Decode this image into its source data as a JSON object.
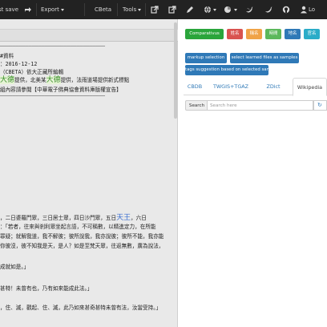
{
  "navbar": {
    "last_save": "st save",
    "export_label": "Export",
    "cbeta_label": "CBeta",
    "tools_label": "Tools",
    "user_label": "Lo",
    "icons": [
      "share-icon",
      "chevron-down-icon",
      "external-link-icon",
      "external-link-icon",
      "pencil-icon",
      "globe-icon",
      "pie-chart-icon",
      "twitter-icon",
      "github-icon",
      "user-icon"
    ]
  },
  "document": {
    "lines": [
      "─────────────────────────────────",
      "#資料",
      "：2016-12-12",
      "（CBETA）依大正藏所編輯",
      "提供，北美某",
      "提供，法雨道場提供新式標點",
      "組內容請參閱【中華電子佛典協會資料庫版權宣告】",
      "─────────────────────────────────",
      "，二日婆羅門眾，三日居士眾，四日沙門眾，五日",
      "，六日",
      "：「若者，往來與剎利眾坐起言語，不可稱數，以精進定力，在所能",
      "罪疑；就解我道，我不解彼；彼所說我，我亦說彼；彼所不能，我亦能",
      "你彼沒，彼不知我是天，是人？如是至梵天眾，往返無數，廣為說法，",
      "成就如是。」",
      "甚特！未曾有也，乃有如來能成此法。」",
      "，住、滅，觀起、住、滅，此乃如來甚奇甚特未曾有法，汝當受持。」"
    ],
    "highlight_da_de": "大德",
    "highlight_tianwang": "天王"
  },
  "right": {
    "buttons_row1": [
      "Comparativus",
      "姓名",
      "稱名",
      "時間",
      "地名",
      "官名"
    ],
    "buttons_row2": [
      "markup selection",
      "select learned files as samples"
    ],
    "buttons_row3": [
      "tags suggestion based on selected samples"
    ],
    "tabs": [
      "CBDB",
      "TWGIS+TGAZ",
      "ZDict",
      "Wikipedia"
    ],
    "active_tab": "Wikipedia",
    "search_label": "Search",
    "search_placeholder": "Search here"
  },
  "colors": {
    "navbar_bg": "#222222",
    "green": "#2aa53b",
    "red": "#d9534f",
    "orange": "#f0a347",
    "light_green": "#5cb85c",
    "blue": "#2f79b7",
    "cyan": "#2bacc8"
  }
}
